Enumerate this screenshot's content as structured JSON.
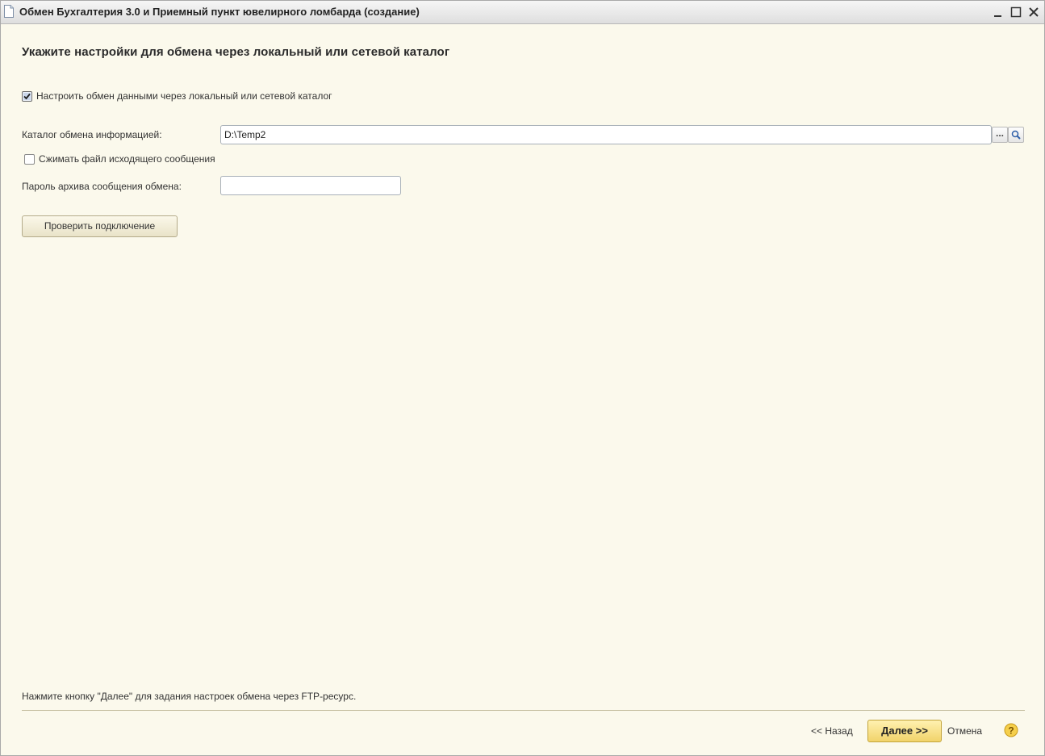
{
  "window": {
    "title": "Обмен Бухгалтерия 3.0 и Приемный пункт ювелирного ломбарда (создание)",
    "controls": {
      "minimize": "minimize-icon",
      "maximize": "maximize-icon",
      "close": "close-icon"
    }
  },
  "form": {
    "heading": "Укажите настройки для обмена через локальный или сетевой каталог",
    "setup_exchange_checkbox": {
      "label": "Настроить обмен данными через локальный или сетевой каталог",
      "checked": true
    },
    "directory_field": {
      "label": "Каталог обмена информацией:",
      "value": "D:\\Temp2",
      "choose_button": "...",
      "open_icon": "magnifier-icon"
    },
    "compress_checkbox": {
      "label": "Сжимать файл исходящего сообщения",
      "checked": false
    },
    "password_field": {
      "label": "Пароль архива сообщения обмена:",
      "value": ""
    },
    "test_connection_button": "Проверить подключение"
  },
  "footer": {
    "hint": "Нажмите кнопку \"Далее\" для задания настроек обмена через FTP-ресурс.",
    "back_button": "<< Назад",
    "next_button": "Далее >>",
    "cancel_button": "Отмена",
    "help_icon": "help-icon"
  },
  "colors": {
    "form_background": "#fbf9ec",
    "primary_button": "#f1d36a",
    "help_icon": "#e8b92c"
  }
}
